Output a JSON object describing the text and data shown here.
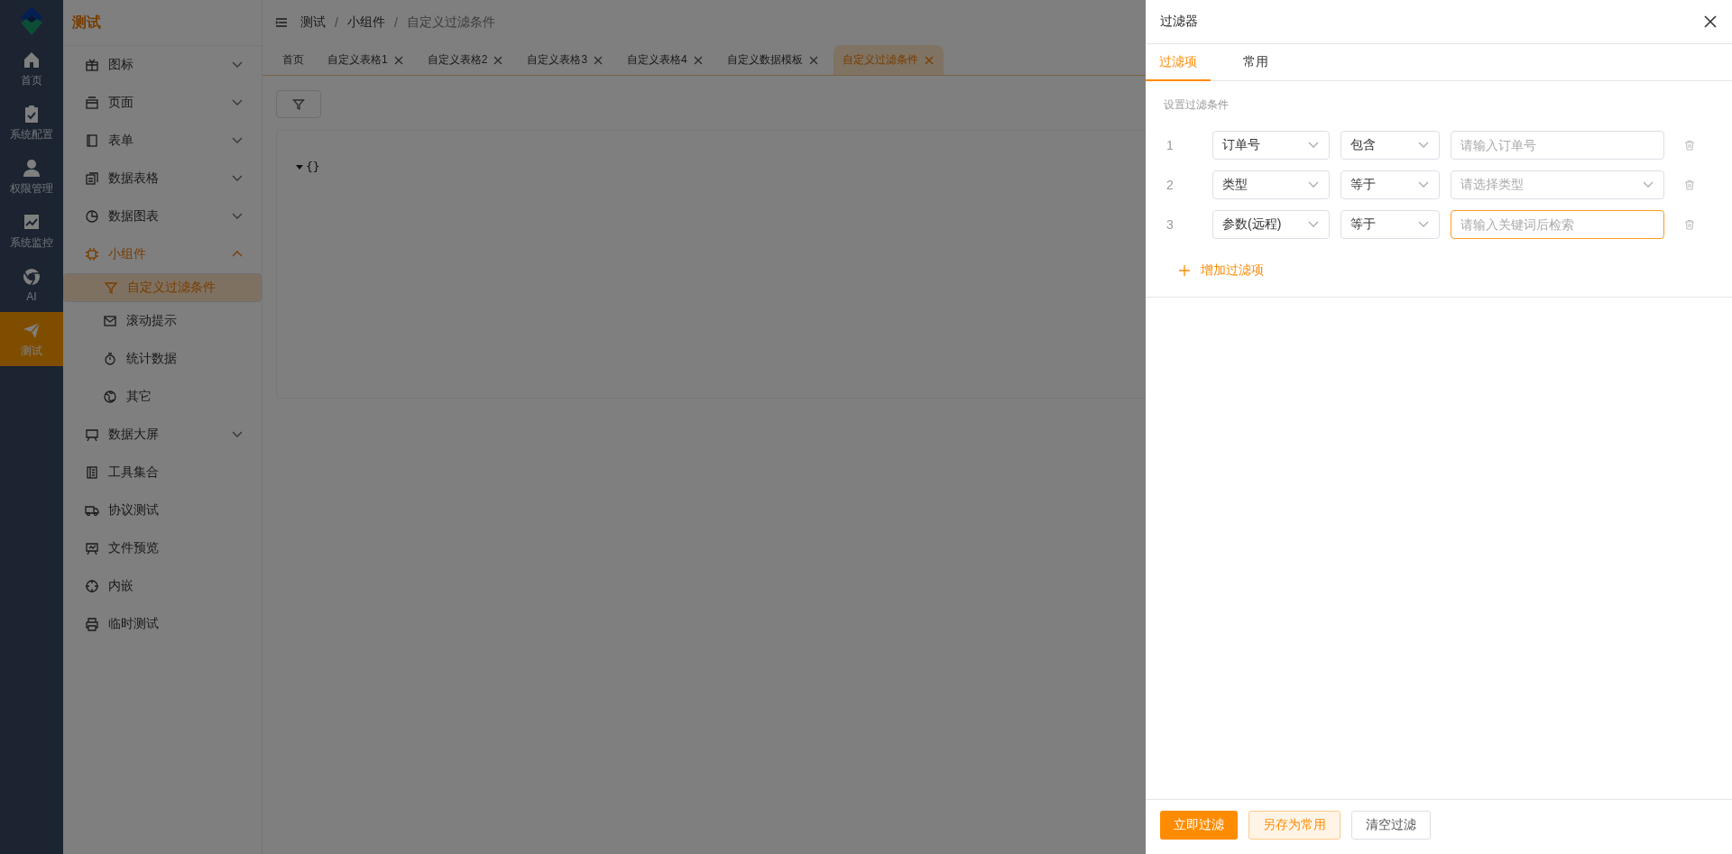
{
  "rail": {
    "items": [
      {
        "label": "首页",
        "selected": false
      },
      {
        "label": "系统配置",
        "selected": false
      },
      {
        "label": "权限管理",
        "selected": false
      },
      {
        "label": "系统监控",
        "selected": false
      },
      {
        "label": "AI",
        "selected": false
      },
      {
        "label": "测试",
        "selected": true
      }
    ]
  },
  "sidebar": {
    "title": "测试",
    "items": [
      {
        "label": "图标",
        "selected": false,
        "expanded": false
      },
      {
        "label": "页面",
        "selected": false,
        "expanded": false
      },
      {
        "label": "表单",
        "selected": false,
        "expanded": false
      },
      {
        "label": "数据表格",
        "selected": false,
        "expanded": false
      },
      {
        "label": "数据图表",
        "selected": false,
        "expanded": false
      },
      {
        "label": "小组件",
        "selected": false,
        "expanded": true,
        "children": [
          {
            "label": "自定义过滤条件",
            "selected": true
          },
          {
            "label": "滚动提示",
            "selected": false
          },
          {
            "label": "统计数据",
            "selected": false
          },
          {
            "label": "其它",
            "selected": false
          }
        ]
      },
      {
        "label": "数据大屏",
        "selected": false,
        "expanded": false
      },
      {
        "label": "工具集合",
        "selected": false
      },
      {
        "label": "协议测试",
        "selected": false
      },
      {
        "label": "文件预览",
        "selected": false
      },
      {
        "label": "内嵌",
        "selected": false
      },
      {
        "label": "临时测试",
        "selected": false
      }
    ]
  },
  "breadcrumb": {
    "separator": "/",
    "items": [
      "测试",
      "小组件",
      "自定义过滤条件"
    ]
  },
  "tabs": [
    {
      "label": "首页",
      "selected": false,
      "closable": false
    },
    {
      "label": "自定义表格1",
      "selected": false,
      "closable": true
    },
    {
      "label": "自定义表格2",
      "selected": false,
      "closable": true
    },
    {
      "label": "自定义表格3",
      "selected": false,
      "closable": true
    },
    {
      "label": "自定义表格4",
      "selected": false,
      "closable": true
    },
    {
      "label": "自定义数据模板",
      "selected": false,
      "closable": true
    },
    {
      "label": "自定义过滤条件",
      "selected": true,
      "closable": true
    }
  ],
  "json_viewer": {
    "text": "{}",
    "expanded": true
  },
  "drawer": {
    "title": "过滤器",
    "tabs": [
      {
        "label": "过滤项",
        "selected": true
      },
      {
        "label": "常用",
        "selected": false
      }
    ],
    "hint": "设置过滤条件",
    "rows": [
      {
        "index": "1",
        "field": "订单号",
        "operator": "包含",
        "value": {
          "kind": "input",
          "placeholder": "请输入订单号",
          "focused": false
        }
      },
      {
        "index": "2",
        "field": "类型",
        "operator": "等于",
        "value": {
          "kind": "select",
          "placeholder": "请选择类型",
          "focused": false
        }
      },
      {
        "index": "3",
        "field": "参数(远程)",
        "operator": "等于",
        "value": {
          "kind": "input",
          "placeholder": "请输入关键词后检索",
          "focused": true
        }
      }
    ],
    "add_label": "增加过滤项",
    "buttons": [
      {
        "label": "立即过滤",
        "kind": "primary"
      },
      {
        "label": "另存为常用",
        "kind": "plain"
      },
      {
        "label": "清空过滤",
        "kind": "default"
      }
    ]
  }
}
